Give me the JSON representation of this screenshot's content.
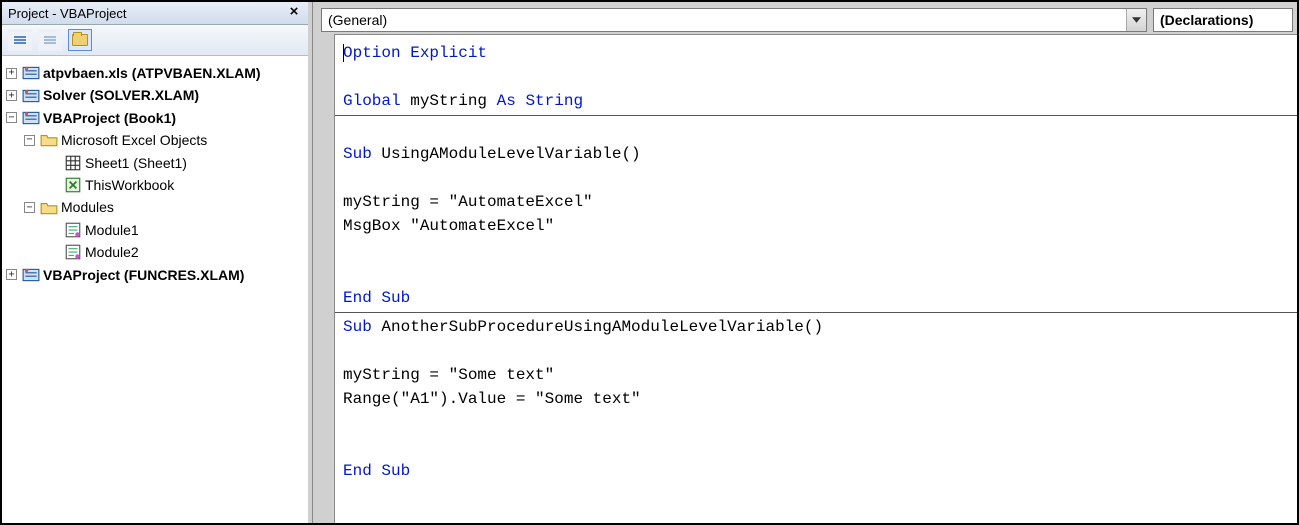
{
  "panel": {
    "title": "Project - VBAProject"
  },
  "tree": {
    "n0": "atpvbaen.xls (ATPVBAEN.XLAM)",
    "n1": "Solver (SOLVER.XLAM)",
    "n2": "VBAProject (Book1)",
    "n2a": "Microsoft Excel Objects",
    "n2a1": "Sheet1 (Sheet1)",
    "n2a2": "ThisWorkbook",
    "n2b": "Modules",
    "n2b1": "Module1",
    "n2b2": "Module2",
    "n3": "VBAProject (FUNCRES.XLAM)"
  },
  "combo": {
    "object": "(General)",
    "proc": "(Declarations)"
  },
  "code": {
    "l1a": "Option",
    "l1b": " Explicit",
    "l2a": "Global",
    "l2b": " myString ",
    "l2c": "As",
    "l2d": " ",
    "l2e": "String",
    "l3a": "Sub",
    "l3b": " UsingAModuleLevelVariable()",
    "l4": "myString = \"AutomateExcel\"",
    "l5": "MsgBox \"AutomateExcel\"",
    "l6a": "End",
    "l6b": " ",
    "l6c": "Sub",
    "l7a": "Sub",
    "l7b": " AnotherSubProcedureUsingAModuleLevelVariable()",
    "l8": "myString = \"Some text\"",
    "l9": "Range(\"A1\").Value = \"Some text\"",
    "l10a": "End",
    "l10b": " ",
    "l10c": "Sub"
  }
}
